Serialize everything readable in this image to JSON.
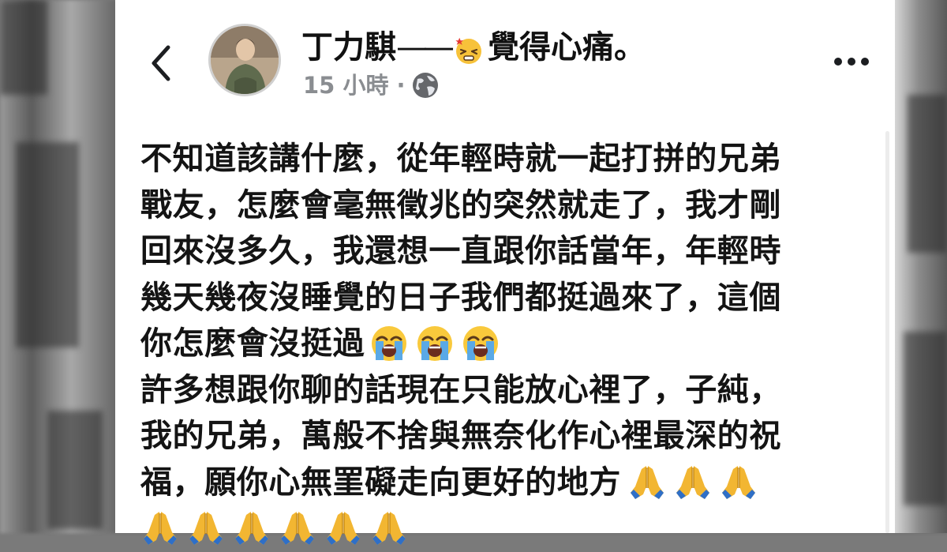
{
  "post": {
    "author": "丁力騏",
    "dash": "——",
    "feeling": "覺得心痛。",
    "timestamp": "15 小時",
    "separator": "·",
    "lines": [
      "不知道該講什麼，從年輕時就一起打拼的兄弟",
      "戰友，怎麼會毫無徵兆的突然就走了，我才剛",
      "回來沒多久，我還想一直跟你話當年，年輕時",
      "幾天幾夜沒睡覺的日子我們都挺過來了，這個",
      "你怎麼會沒挺過",
      "許多想跟你聊的話現在只能放心裡了，子純，",
      "我的兄弟，萬般不捨與無奈化作心裡最深的祝",
      "福，願你心無罣礙走向更好的地方"
    ]
  },
  "icons": {
    "back": "chevron-left-icon",
    "feeling": "pained-face-emoji",
    "privacy": "globe-icon",
    "more": "more-dots-icon",
    "crying": "loudly-crying-face-emoji",
    "praying": "folded-hands-emoji"
  },
  "colors": {
    "card": "#ffffff",
    "text": "#141414",
    "meta": "#8a8d91"
  }
}
